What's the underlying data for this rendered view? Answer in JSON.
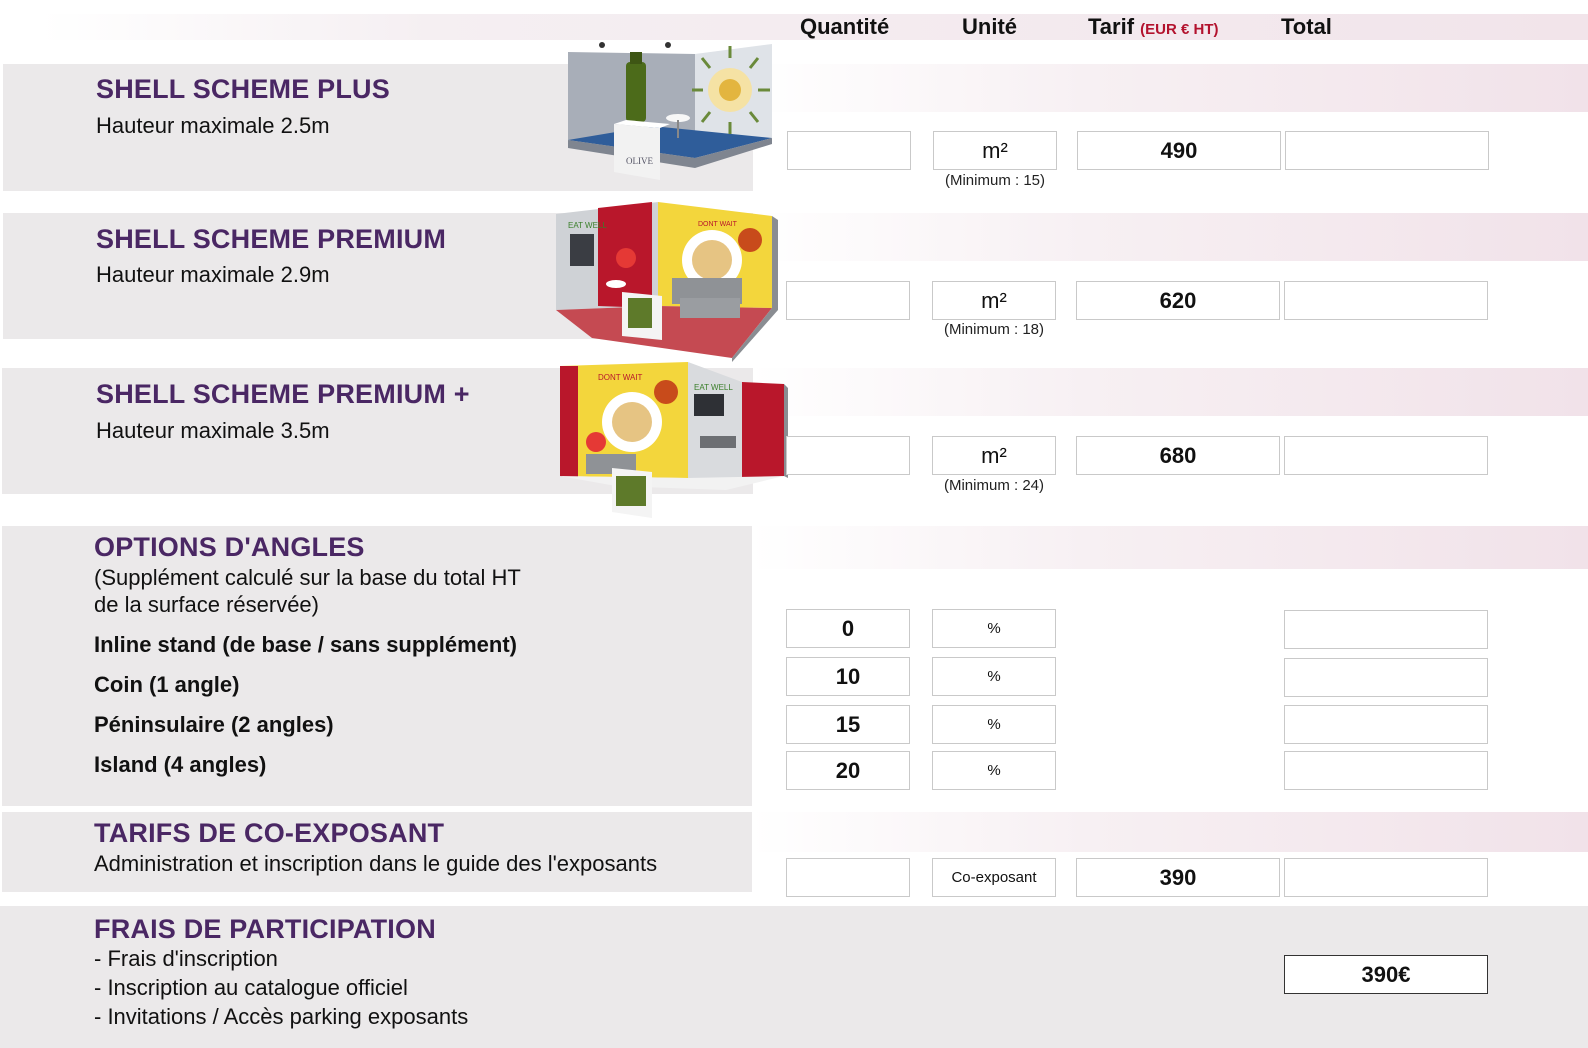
{
  "columns": {
    "quantite": "Quantité",
    "unite": "Unité",
    "tarif": "Tarif",
    "tarif_unit": "(EUR € HT)",
    "total": "Total"
  },
  "packages": [
    {
      "title": "SHELL SCHEME PLUS",
      "height": "Hauteur maximale 2.5m",
      "unit": "m²",
      "minimum": "(Minimum : 15)",
      "price": "490"
    },
    {
      "title": "SHELL SCHEME PREMIUM",
      "height": "Hauteur maximale 2.9m",
      "unit": "m²",
      "minimum": "(Minimum : 18)",
      "price": "620"
    },
    {
      "title": "SHELL SCHEME PREMIUM +",
      "height": "Hauteur maximale 3.5m",
      "unit": "m²",
      "minimum": "(Minimum : 24)",
      "price": "680"
    }
  ],
  "angles": {
    "title": "OPTIONS D'ANGLES",
    "note_line1": "(Supplément calculé sur la base du total HT",
    "note_line2": "de la surface réservée)",
    "items": [
      {
        "label": "Inline stand (de base / sans supplément)",
        "value": "0",
        "unit": "%"
      },
      {
        "label": "Coin (1 angle)",
        "value": "10",
        "unit": "%"
      },
      {
        "label": "Péninsulaire (2 angles)",
        "value": "15",
        "unit": "%"
      },
      {
        "label": "Island (4 angles)",
        "value": "20",
        "unit": "%"
      }
    ]
  },
  "coexposant": {
    "title": "TARIFS DE CO-EXPOSANT",
    "desc": "Administration et inscription dans le guide des l'exposants",
    "unit": "Co-exposant",
    "price": "390"
  },
  "frais": {
    "title": "FRAIS DE PARTICIPATION",
    "items": [
      "- Frais d'inscription",
      "- Inscription au catalogue officiel",
      "- Invitations / Accès parking exposants"
    ],
    "total": "390€"
  },
  "images": {
    "stand1": {
      "sign": "OLIVE",
      "sign2": "OLIVE"
    },
    "stand2": {
      "sign": "EAT WELL",
      "sign2": "DONT WAIT"
    },
    "stand3": {
      "sign": "DONT WAIT",
      "sign2": "EAT WELL"
    }
  },
  "colors": {
    "title": "#4a2764",
    "accent": "#b3122e",
    "panel": "#ebe9ea"
  }
}
